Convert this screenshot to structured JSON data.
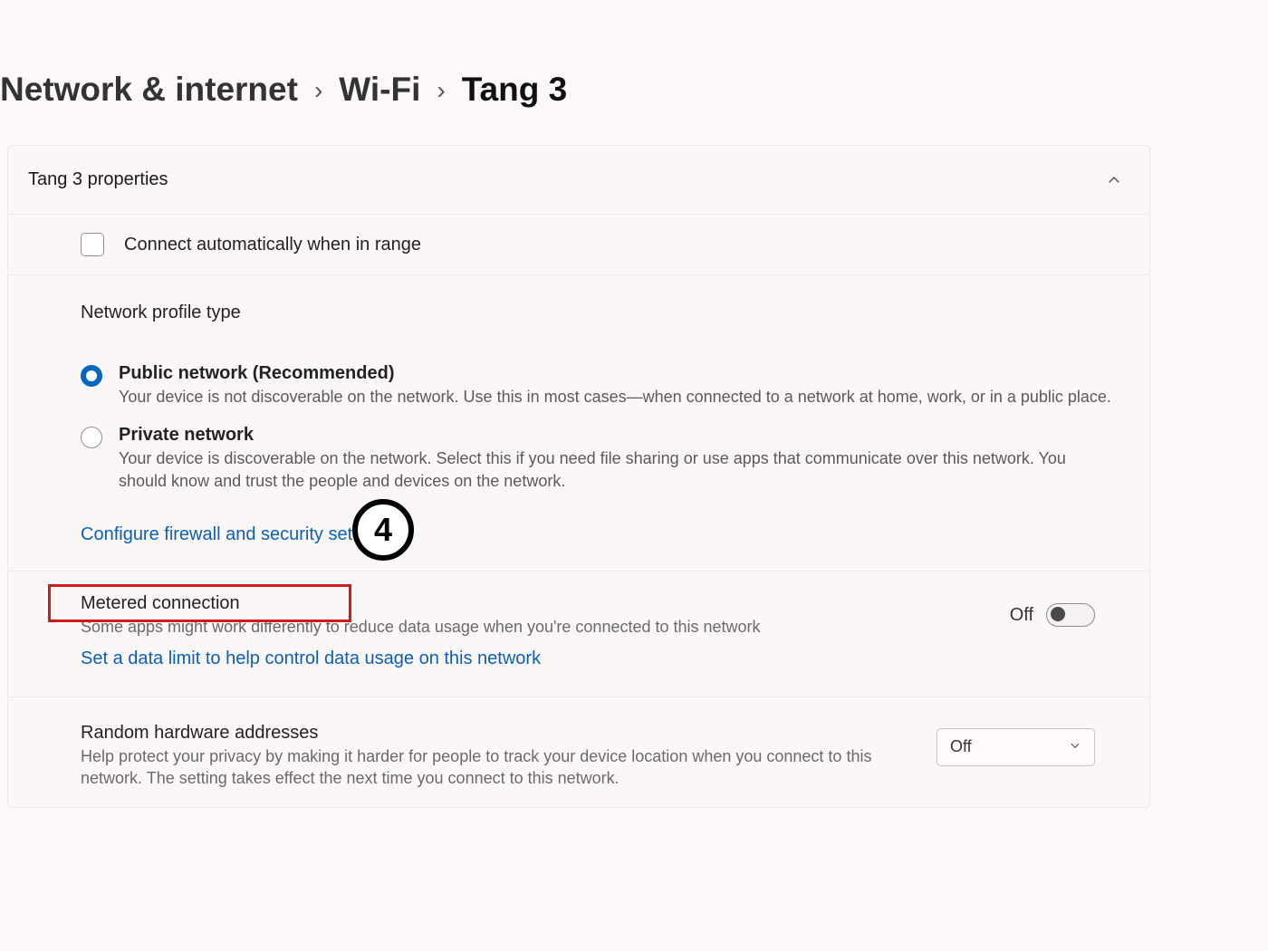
{
  "breadcrumb": {
    "items": [
      "Network & internet",
      "Wi-Fi",
      "Tang 3"
    ]
  },
  "properties": {
    "header": "Tang 3 properties",
    "auto_connect_label": "Connect automatically when in range",
    "auto_connect_checked": false,
    "profile_type_heading": "Network profile type",
    "profiles": [
      {
        "label": "Public network (Recommended)",
        "desc": "Your device is not discoverable on the network. Use this in most cases—when connected to a network at home, work, or in a public place.",
        "selected": true
      },
      {
        "label": "Private network",
        "desc": "Your device is discoverable on the network. Select this if you need file sharing or use apps that communicate over this network. You should know and trust the people and devices on the network.",
        "selected": false
      }
    ],
    "firewall_link": "Configure firewall and security settings"
  },
  "metered": {
    "title": "Metered connection",
    "desc": "Some apps might work differently to reduce data usage when you're connected to this network",
    "state_label": "Off",
    "state_on": false,
    "data_limit_link": "Set a data limit to help control data usage on this network"
  },
  "random_hw": {
    "title": "Random hardware addresses",
    "desc": "Help protect your privacy by making it harder for people to track your device location when you connect to this network. The setting takes effect the next time you connect to this network.",
    "select_value": "Off"
  },
  "annotation": {
    "step": "4"
  }
}
